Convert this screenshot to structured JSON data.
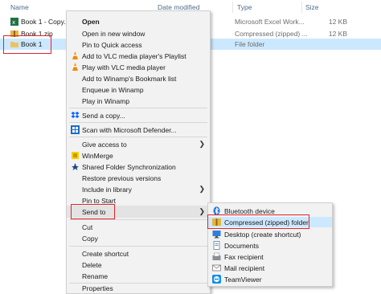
{
  "header": {
    "col_name": "Name",
    "col_date": "Date modified",
    "col_type": "Type",
    "col_size": "Size"
  },
  "files": [
    {
      "name": "Book 1 - Copy.xlsx",
      "type": "Microsoft Excel Work...",
      "size": "12 KB",
      "icon": "excel-file-icon"
    },
    {
      "name": "Book 1.zip",
      "type": "Compressed (zipped) ...",
      "size": "12 KB",
      "icon": "zip-folder-icon"
    },
    {
      "name": "Book 1",
      "type": "File folder",
      "size": "",
      "icon": "folder-icon",
      "selected": true
    }
  ],
  "context_menu": {
    "open": "Open",
    "open_new_window": "Open in new window",
    "pin_quick_access": "Pin to Quick access",
    "vlc_playlist": "Add to VLC media player's Playlist",
    "vlc_play": "Play with VLC media player",
    "winamp_bookmark": "Add to Winamp's Bookmark list",
    "winamp_enqueue": "Enqueue in Winamp",
    "winamp_play": "Play in Winamp",
    "send_copy": "Send a copy...",
    "defender_scan": "Scan with Microsoft Defender...",
    "give_access": "Give access to",
    "winmerge": "WinMerge",
    "shared_sync": "Shared Folder Synchronization",
    "restore_versions": "Restore previous versions",
    "include_library": "Include in library",
    "pin_start": "Pin to Start",
    "send_to": "Send to",
    "cut": "Cut",
    "copy": "Copy",
    "create_shortcut": "Create shortcut",
    "delete": "Delete",
    "rename": "Rename",
    "properties": "Properties"
  },
  "send_to_menu": {
    "bluetooth": "Bluetooth device",
    "compressed": "Compressed (zipped) folder",
    "desktop": "Desktop (create shortcut)",
    "documents": "Documents",
    "fax": "Fax recipient",
    "mail": "Mail recipient",
    "teamviewer": "TeamViewer"
  },
  "colors": {
    "highlight": "#e0242c",
    "selection": "#cce8ff",
    "menu_bg": "#f2f2f2"
  }
}
